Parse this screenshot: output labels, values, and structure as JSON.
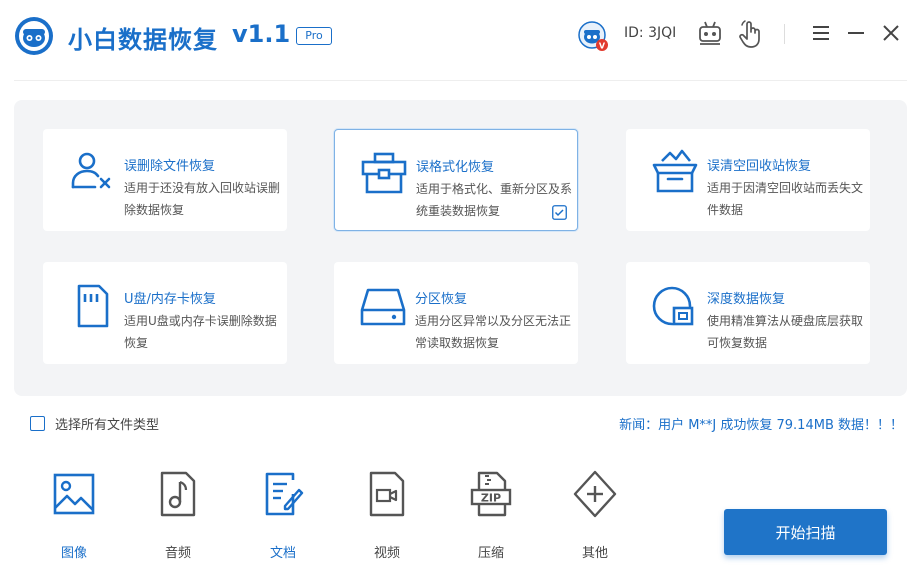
{
  "titlebar": {
    "app_name": "小白数据恢复",
    "version": "v1.1",
    "badge": "Pro",
    "user_id": "ID: 3JQI",
    "avatar_badge": "V"
  },
  "cards": [
    {
      "title": "误删除文件恢复",
      "desc": "适用于还没有放入回收站误删除数据恢复",
      "icon": "user-remove-icon"
    },
    {
      "title": "误格式化恢复",
      "desc": "适用于格式化、重新分区及系统重装数据恢复",
      "icon": "toolbox-icon",
      "selected": true
    },
    {
      "title": "误清空回收站恢复",
      "desc": "适用于因清空回收站而丢失文件数据",
      "icon": "recycle-bin-icon"
    },
    {
      "title": "U盘/内存卡恢复",
      "desc": "适用U盘或内存卡误删除数据恢复",
      "icon": "sd-card-icon"
    },
    {
      "title": "分区恢复",
      "desc": "适用分区异常以及分区无法正常读取数据恢复",
      "icon": "hard-drive-icon"
    },
    {
      "title": "深度数据恢复",
      "desc": "使用精准算法从硬盘底层获取可恢复数据",
      "icon": "deep-scan-icon"
    }
  ],
  "select_all": {
    "label": "选择所有文件类型",
    "checked": false
  },
  "news": "新闻：用户 M**J 成功恢复 79.14MB 数据！！！",
  "file_types": [
    {
      "label": "图像",
      "icon": "image-icon",
      "active": true
    },
    {
      "label": "音频",
      "icon": "audio-icon",
      "active": false
    },
    {
      "label": "文档",
      "icon": "document-icon",
      "active": true
    },
    {
      "label": "视频",
      "icon": "video-icon",
      "active": false
    },
    {
      "label": "压缩",
      "icon": "zip-icon",
      "active": false
    },
    {
      "label": "其他",
      "icon": "other-icon",
      "active": false
    }
  ],
  "scan_button": "开始扫描",
  "colors": {
    "accent": "#1a6fc9",
    "button": "#1f74c8",
    "panel": "#f3f4f6",
    "gray_icon": "#555555"
  }
}
